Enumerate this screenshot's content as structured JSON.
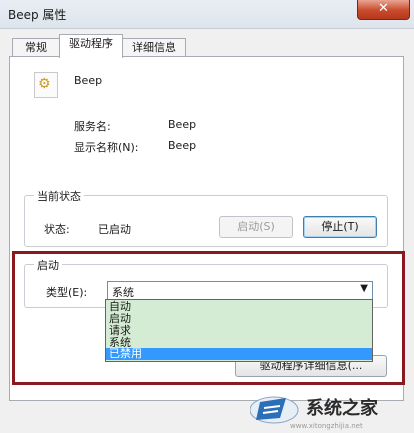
{
  "window": {
    "title": "Beep 属性",
    "close_label": "✕"
  },
  "tabs": [
    {
      "label": "常规",
      "active": false
    },
    {
      "label": "驱动程序",
      "active": true
    },
    {
      "label": "详细信息",
      "active": false
    }
  ],
  "device": {
    "icon": "gear-document-icon",
    "name": "Beep"
  },
  "fields": {
    "service_label": "服务名:",
    "service_value": "Beep",
    "display_label": "显示名称(N):",
    "display_value": "Beep"
  },
  "status_group": {
    "legend": "当前状态",
    "status_label": "状态:",
    "status_value": "已启动",
    "start_button": "启动(S)",
    "stop_button": "停止(T)"
  },
  "startup_group": {
    "legend": "启动",
    "type_label": "类型(E):",
    "type_value": "系统",
    "options": [
      "自动",
      "启动",
      "请求",
      "系统",
      "已禁用"
    ],
    "selected_index": 4,
    "driver_details_button": "驱动程序详细信息(..."
  },
  "watermark": {
    "text": "系统之家",
    "url_fragment": "www.xitongzhijia.net"
  },
  "colors": {
    "highlight_border": "#8b1a1f",
    "dropdown_bg": "#d4ecd4",
    "selection": "#3399ff"
  }
}
